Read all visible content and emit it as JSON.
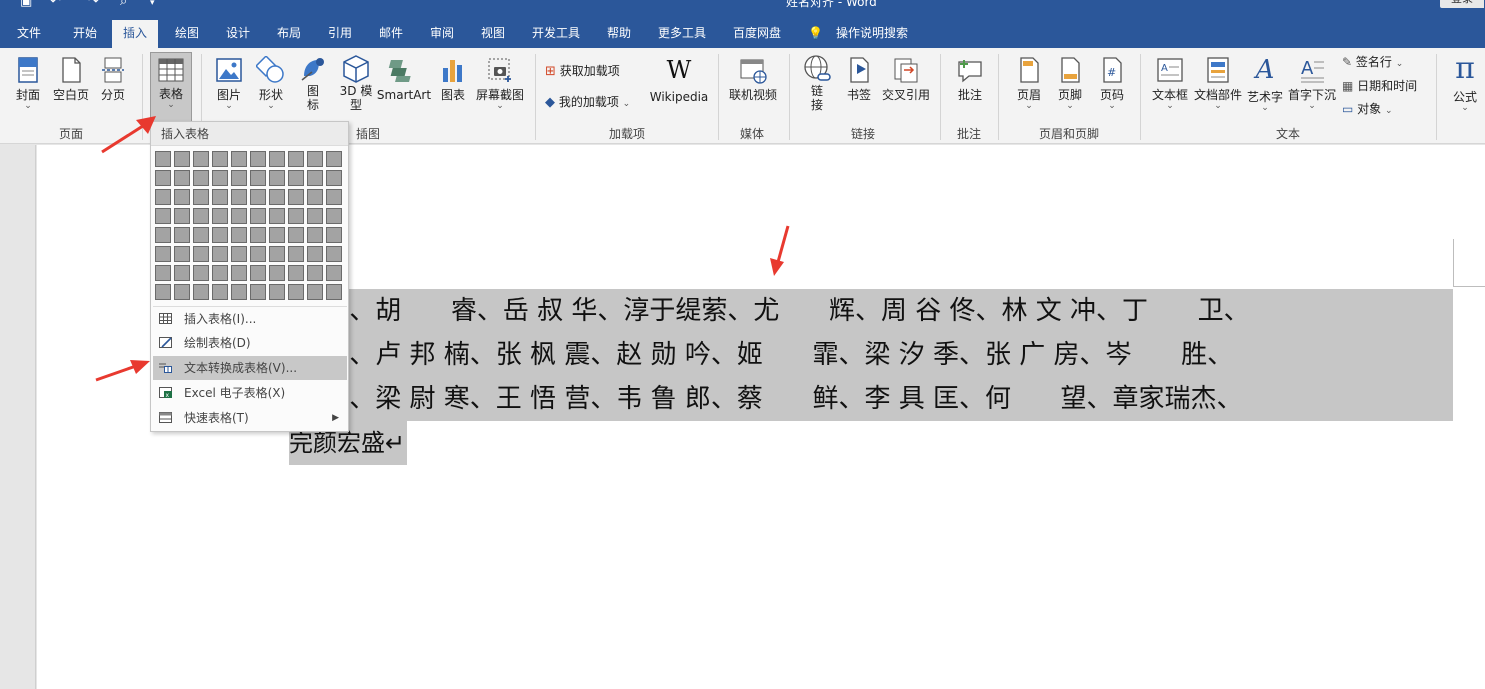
{
  "titlebar": {
    "title": "姓名对齐 - Word",
    "login": "登录"
  },
  "tabs": [
    "文件",
    "开始",
    "插入",
    "绘图",
    "设计",
    "布局",
    "引用",
    "邮件",
    "审阅",
    "视图",
    "开发工具",
    "帮助",
    "更多工具",
    "百度网盘"
  ],
  "tell_me": "操作说明搜索",
  "ribbon": {
    "pages": {
      "cover": "封面",
      "blank": "空白页",
      "break": "分页",
      "group": "页面"
    },
    "table": {
      "label": "表格"
    },
    "illustrations": {
      "picture": "图片",
      "shapes": "形状",
      "icons_1": "图",
      "icons_2": "标",
      "model_1": "3D 模",
      "model_2": "型",
      "smartart": "SmartArt",
      "chart": "图表",
      "screenshot": "屏幕截图",
      "group": "插图"
    },
    "addins": {
      "get": "获取加载项",
      "my": "我的加载项",
      "wikipedia": "Wikipedia",
      "group": "加载项"
    },
    "media": {
      "video": "联机视频",
      "group": "媒体"
    },
    "links": {
      "link_1": "链",
      "link_2": "接",
      "bookmark": "书签",
      "crossref": "交叉引用",
      "group": "链接"
    },
    "comments": {
      "comment": "批注",
      "group": "批注"
    },
    "headerfooter": {
      "header": "页眉",
      "footer": "页脚",
      "pagenum": "页码",
      "group": "页眉和页脚"
    },
    "text": {
      "textbox": "文本框",
      "parts": "文档部件",
      "wordart": "艺术字",
      "dropcap": "首字下沉",
      "signature": "签名行",
      "datetime": "日期和时间",
      "object": "对象",
      "group": "文本"
    },
    "symbols": {
      "equation": "公式"
    }
  },
  "dropdown": {
    "header": "插入表格",
    "items": [
      "插入表格(I)...",
      "绘制表格(D)",
      "文本转换成表格(V)...",
      "Excel 电子表格(X)",
      "快速表格(T)"
    ]
  },
  "document": {
    "lines": [
      "昭 焱、胡      睿、岳 叔 华、淳于缇萦、尤      辉、周 谷 佟、林 文 冲、丁      卫、",
      "树 琪、卢 邦 楠、张 枫 震、赵 勋 吟、姬      霏、梁 汐 季、张 广 房、岑      胜、",
      "亚 思、梁 尉 寒、王 悟 营、韦 鲁 郎、蔡      鲜、李 具 匡、何      望、章家瑞杰、",
      "完颜宏盛↵"
    ]
  },
  "colors": {
    "brand": "#2b579a",
    "highlight": "#c6c6c6",
    "arrow": "#e8392f"
  }
}
